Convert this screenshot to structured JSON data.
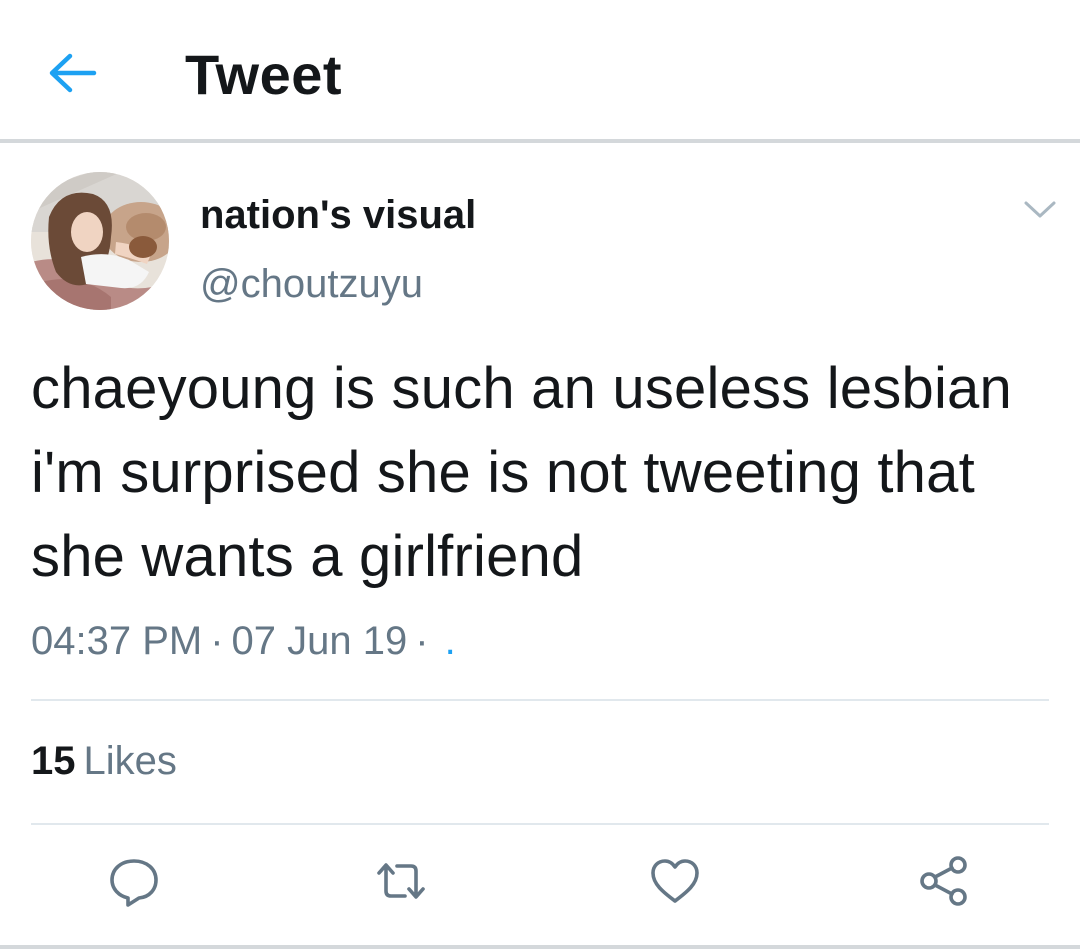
{
  "header": {
    "title": "Tweet",
    "back_icon": "arrow-left-icon",
    "accent": "#1da1f2"
  },
  "author": {
    "display_name": "nation's visual",
    "handle": "@choutzuyu",
    "avatar_icon": "profile-photo"
  },
  "tweet": {
    "text": "chaeyoung is such an useless lesbian i'm surprised she is not tweeting that she wants a girlfriend",
    "time": "04:37 PM",
    "separator": "·",
    "date": "07 Jun 19",
    "source_link": "."
  },
  "stats": {
    "likes_count": "15",
    "likes_label": "Likes"
  },
  "actions": {
    "reply_icon": "reply-icon",
    "retweet_icon": "retweet-icon",
    "like_icon": "heart-icon",
    "share_icon": "share-icon"
  },
  "colors": {
    "text_primary": "#14171a",
    "text_secondary": "#657786",
    "link": "#1da1f2",
    "divider": "#e1e8ed"
  }
}
